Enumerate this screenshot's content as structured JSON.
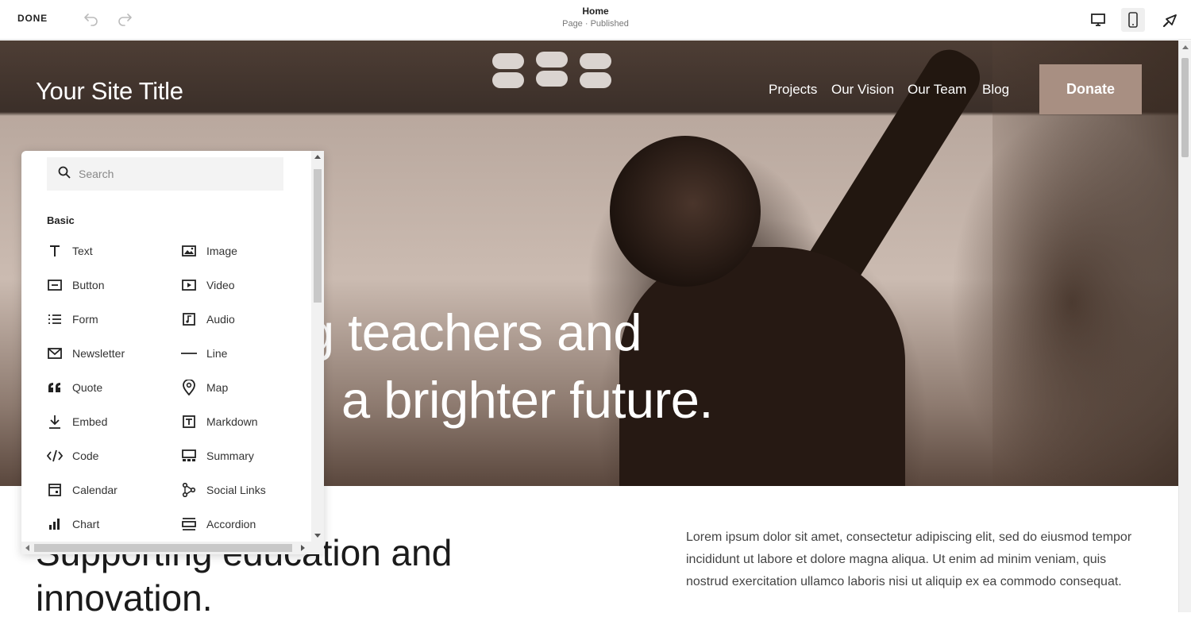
{
  "topbar": {
    "done_label": "DONE",
    "page_name": "Home",
    "page_status": "Page · Published",
    "icons": [
      "undo-icon",
      "redo-icon",
      "desktop-view-icon",
      "mobile-view-icon",
      "design-brush-icon"
    ]
  },
  "site": {
    "title": "Your Site Title",
    "nav": [
      "Projects",
      "Our Vision",
      "Our Team",
      "Blog"
    ],
    "donate_label": "Donate",
    "donate_color": "#a88f82",
    "headline_line1": "g teachers and",
    "headline_line2": "a brighter future."
  },
  "section": {
    "heading_line1": "Supporting education and",
    "heading_line2": "innovation.",
    "body": "Lorem ipsum dolor sit amet, consectetur adipiscing elit, sed do eiusmod tempor incididunt ut labore et dolore magna aliqua. Ut enim ad minim veniam, quis nostrud exercitation ullamco laboris nisi ut aliquip ex ea commodo consequat."
  },
  "picker": {
    "search_placeholder": "Search",
    "section_label": "Basic",
    "items": [
      {
        "label": "Text",
        "icon": "text-icon"
      },
      {
        "label": "Image",
        "icon": "image-icon"
      },
      {
        "label": "Button",
        "icon": "button-icon"
      },
      {
        "label": "Video",
        "icon": "video-icon"
      },
      {
        "label": "Form",
        "icon": "form-icon"
      },
      {
        "label": "Audio",
        "icon": "audio-icon"
      },
      {
        "label": "Newsletter",
        "icon": "newsletter-icon"
      },
      {
        "label": "Line",
        "icon": "line-icon"
      },
      {
        "label": "Quote",
        "icon": "quote-icon"
      },
      {
        "label": "Map",
        "icon": "map-pin-icon"
      },
      {
        "label": "Embed",
        "icon": "embed-icon"
      },
      {
        "label": "Markdown",
        "icon": "markdown-icon"
      },
      {
        "label": "Code",
        "icon": "code-icon"
      },
      {
        "label": "Summary",
        "icon": "summary-icon"
      },
      {
        "label": "Calendar",
        "icon": "calendar-icon"
      },
      {
        "label": "Social Links",
        "icon": "social-links-icon"
      },
      {
        "label": "Chart",
        "icon": "chart-icon"
      },
      {
        "label": "Accordion",
        "icon": "accordion-icon"
      }
    ]
  }
}
